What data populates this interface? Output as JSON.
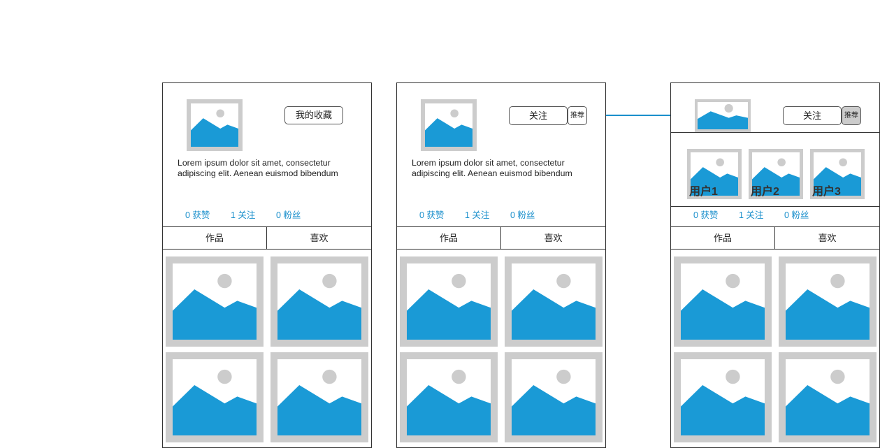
{
  "colors": {
    "accent": "#1a9ad6",
    "placeholder_frame": "#cccccc",
    "link": "#1a8fcc",
    "border": "#333333",
    "active_button": "#cccccc"
  },
  "panels": [
    {
      "variant": "own-profile",
      "avatar_icon": "image-placeholder-icon",
      "favorites_button": "我的收藏",
      "bio": "Lorem ipsum dolor sit amet, consectetur\nadipiscing elit. Aenean euismod bibendum",
      "stats": {
        "likes": "0 获赞",
        "following": "1 关注",
        "fans": "0 粉丝"
      },
      "tabs": [
        "作品",
        "喜欢"
      ]
    },
    {
      "variant": "other-profile",
      "avatar_icon": "image-placeholder-icon",
      "follow_button": "关注",
      "recommend_button": "推荐",
      "bio": "Lorem ipsum dolor sit amet, consectetur\nadipiscing elit. Aenean euismod bibendum",
      "stats": {
        "likes": "0 获赞",
        "following": "1 关注",
        "fans": "0 粉丝"
      },
      "tabs": [
        "作品",
        "喜欢"
      ]
    },
    {
      "variant": "other-profile-recommend-open",
      "avatar_icon": "image-placeholder-icon",
      "follow_button": "关注",
      "recommend_button": "推荐",
      "recommended_users": [
        "用户1",
        "用户2",
        "用户3"
      ],
      "stats": {
        "likes": "0 获赞",
        "following": "1 关注",
        "fans": "0 粉丝"
      },
      "tabs": [
        "作品",
        "喜欢"
      ]
    }
  ]
}
